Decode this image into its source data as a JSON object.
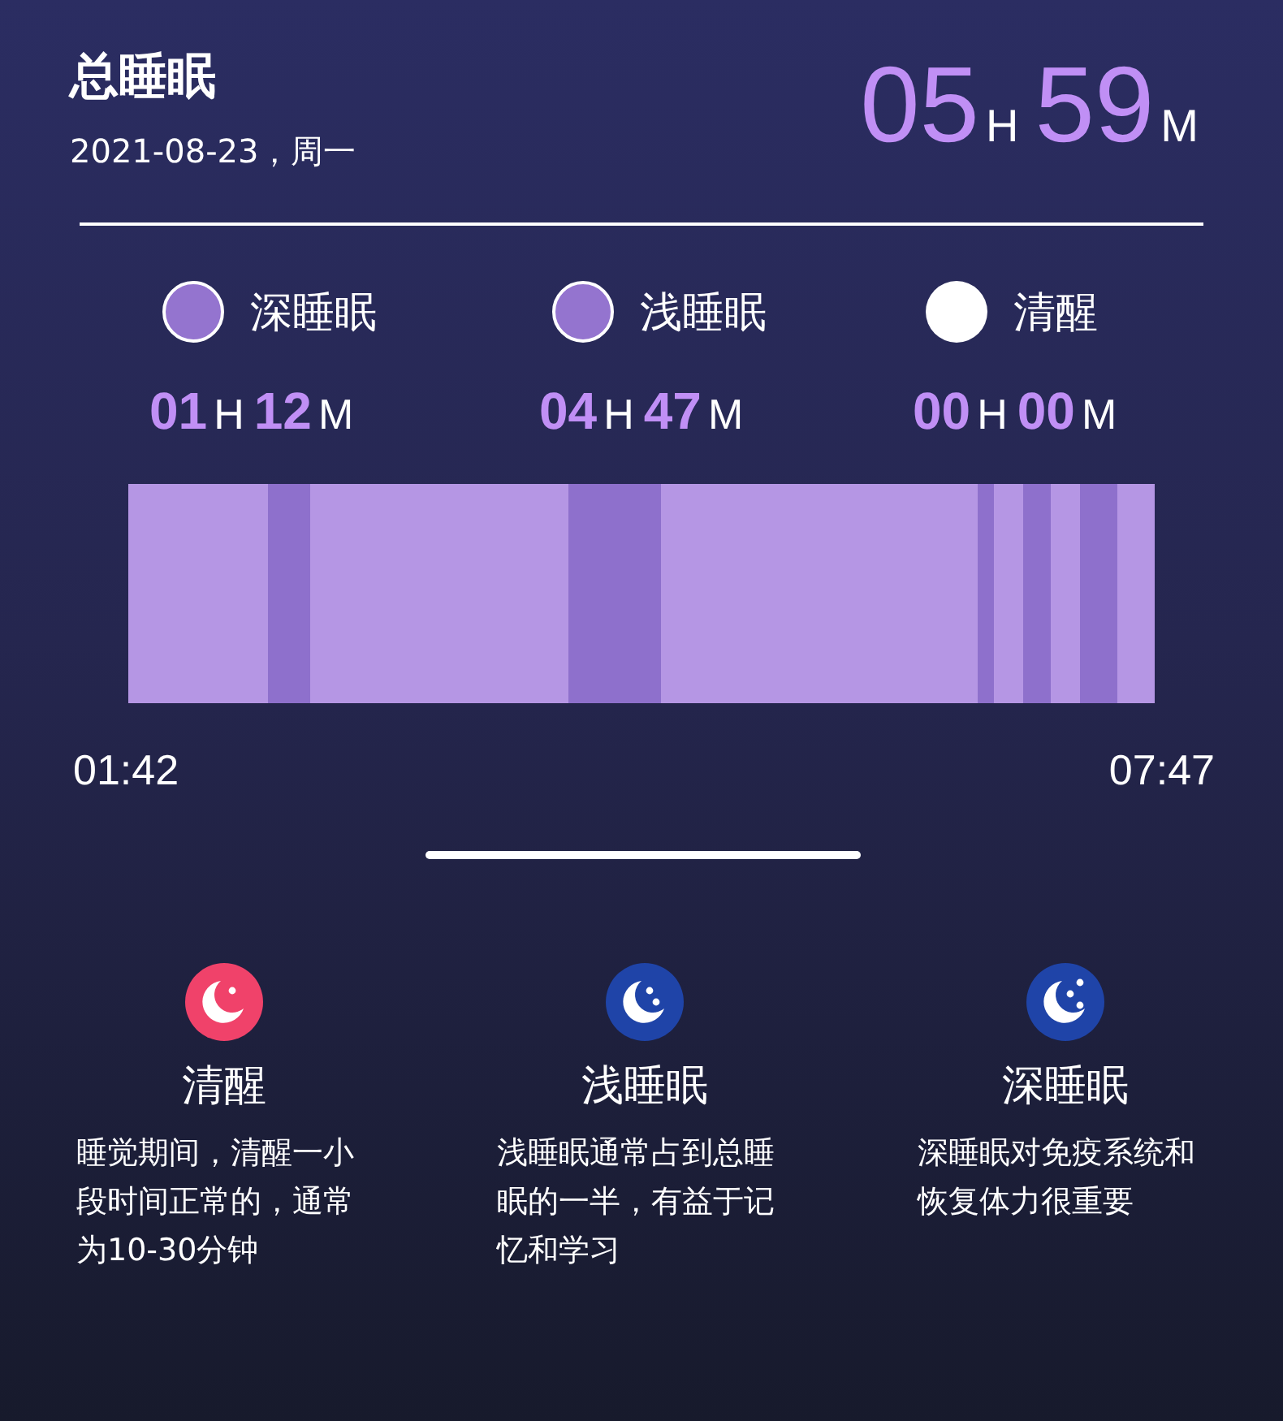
{
  "header": {
    "title": "总睡眠",
    "date": "2021-08-23，周一",
    "total": {
      "hours": "05",
      "hours_unit": "H",
      "minutes": "59",
      "minutes_unit": "M"
    }
  },
  "legend": [
    {
      "label": "深睡眠",
      "color": "#9474cf",
      "hours": "01",
      "hours_unit": "H",
      "minutes": "12",
      "minutes_unit": "M"
    },
    {
      "label": "浅睡眠",
      "color": "#9474cf",
      "hours": "04",
      "hours_unit": "H",
      "minutes": "47",
      "minutes_unit": "M"
    },
    {
      "label": "清醒",
      "color": "#ffffff",
      "hours": "00",
      "hours_unit": "H",
      "minutes": "00",
      "minutes_unit": "M"
    }
  ],
  "timeline": {
    "start": "01:42",
    "end": "07:47"
  },
  "cards": [
    {
      "kind": "awake",
      "color": "#f0426a",
      "title": "清醒",
      "text": "睡觉期间，清醒一小段时间正常的，通常为10-30分钟"
    },
    {
      "kind": "light",
      "color": "#1f44a8",
      "title": "浅睡眠",
      "text": "浅睡眠通常占到总睡眠的一半，有益于记忆和学习"
    },
    {
      "kind": "deep",
      "color": "#1f44a8",
      "title": "深睡眠",
      "text": "深睡眠对免疫系统和恢复体力很重要"
    }
  ]
}
